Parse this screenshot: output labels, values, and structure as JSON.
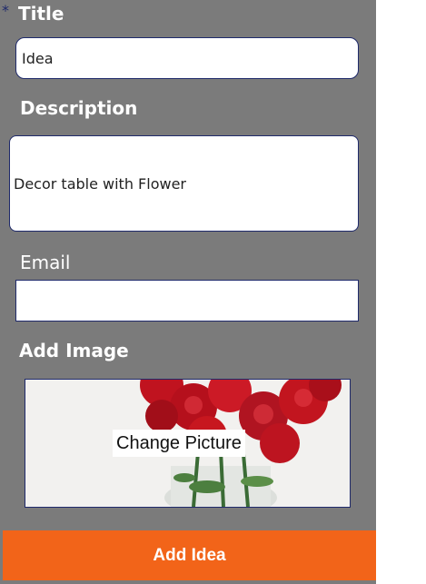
{
  "form": {
    "required_marker": "*",
    "title_label": "Title",
    "title_value": "Idea",
    "description_label": "Description",
    "description_value": "Decor table with Flower",
    "email_label": "Email",
    "email_value": "",
    "image_label": "Add Image",
    "change_picture_label": "Change Picture",
    "submit_label": "Add Idea"
  },
  "colors": {
    "panel": "#7b7b7b",
    "accent": "#f26419",
    "field_border": "#1f2a6b"
  }
}
